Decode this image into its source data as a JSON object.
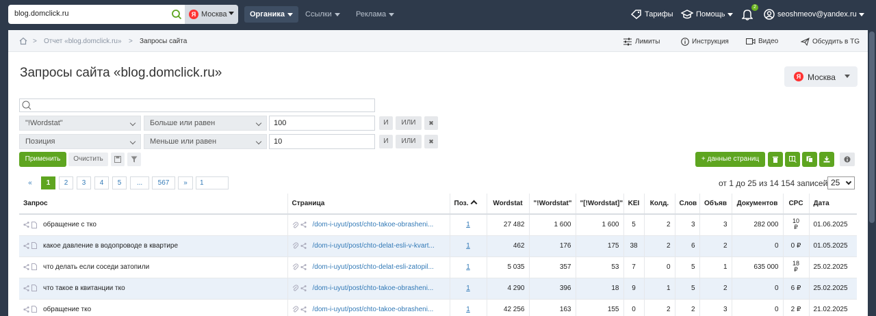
{
  "topbar": {
    "search_value": "blog.domclick.ru",
    "region": "Москва",
    "region_badge": "Я",
    "nav": [
      "Органика",
      "Ссылки",
      "Реклама"
    ],
    "tariffs": "Тарифы",
    "help": "Помощь",
    "bell_count": "2",
    "user": "seoshmeov@yandex.ru"
  },
  "breadcrumb": {
    "report": "Отчет «blog.domclick.ru»",
    "current": "Запросы сайта",
    "tools": [
      "Лимиты",
      "Инструкция",
      "Видео",
      "Обсудить в TG"
    ]
  },
  "page": {
    "title": "Запросы сайта «blog.domclick.ru»",
    "region": "Москва"
  },
  "filters": {
    "rows": [
      {
        "field": "\"!Wordstat\"",
        "op": "Больше или равен",
        "value": "100"
      },
      {
        "field": "Позиция",
        "op": "Меньше или равен",
        "value": "10"
      }
    ],
    "and_label": "И",
    "or_label": "ИЛИ",
    "remove_label": "✖",
    "apply": "Применить",
    "clear": "Очистить"
  },
  "actions": {
    "page_data": "+ данные страниц"
  },
  "pagination": {
    "prev": "«",
    "pages": [
      "1",
      "2",
      "3",
      "4",
      "5",
      "...",
      "567"
    ],
    "next": "»",
    "jump_value": "1",
    "records": "от 1 до 25 из 14 154 записей",
    "per_page": "25"
  },
  "table": {
    "headers": [
      "Запрос",
      "Страница",
      "Поз.",
      "Wordstat",
      "\"!Wordstat\"",
      "\"[!Wordstat]\"",
      "KEI",
      "Колд.",
      "Слов",
      "Объяв",
      "Документов",
      "CPC",
      "Дата"
    ],
    "rows": [
      {
        "query": "обращение с тко",
        "page": "/dom-i-uyut/post/chto-takoe-obrasheni...",
        "pos": "1",
        "ws": "27 482",
        "ws2": "1 600",
        "ws3": "1 600",
        "kei": "5",
        "kold": "2",
        "words": "3",
        "ads": "3",
        "docs": "282 000",
        "cpc_top": "10",
        "cpc_bottom": "₽",
        "date": "01.06.2025"
      },
      {
        "query": "какое давление в водопроводе в квартире",
        "page": "/dom-i-uyut/post/chto-delat-esli-v-kvart...",
        "pos": "1",
        "ws": "462",
        "ws2": "176",
        "ws3": "175",
        "kei": "38",
        "kold": "2",
        "words": "6",
        "ads": "2",
        "docs": "0",
        "cpc_top": "0 ₽",
        "cpc_bottom": "",
        "date": "01.05.2025"
      },
      {
        "query": "что делать если соседи затопили",
        "page": "/dom-i-uyut/post/chto-delat-esli-zatopil...",
        "pos": "1",
        "ws": "5 035",
        "ws2": "357",
        "ws3": "53",
        "kei": "7",
        "kold": "0",
        "words": "5",
        "ads": "1",
        "docs": "635 000",
        "cpc_top": "18",
        "cpc_bottom": "₽",
        "date": "25.02.2025"
      },
      {
        "query": "что такое в квитанции тко",
        "page": "/dom-i-uyut/post/chto-takoe-obrasheni...",
        "pos": "1",
        "ws": "4 290",
        "ws2": "396",
        "ws3": "18",
        "kei": "9",
        "kold": "1",
        "words": "5",
        "ads": "2",
        "docs": "0",
        "cpc_top": "6 ₽",
        "cpc_bottom": "",
        "date": "25.02.2025"
      },
      {
        "query": "обращение тко",
        "page": "/dom-i-uyut/post/chto-takoe-obrasheni...",
        "pos": "1",
        "ws": "42 256",
        "ws2": "163",
        "ws3": "155",
        "kei": "0",
        "kold": "2",
        "words": "2",
        "ads": "3",
        "docs": "0",
        "cpc_top": "2 ₽",
        "cpc_bottom": "",
        "date": "21.02.2025"
      }
    ]
  }
}
